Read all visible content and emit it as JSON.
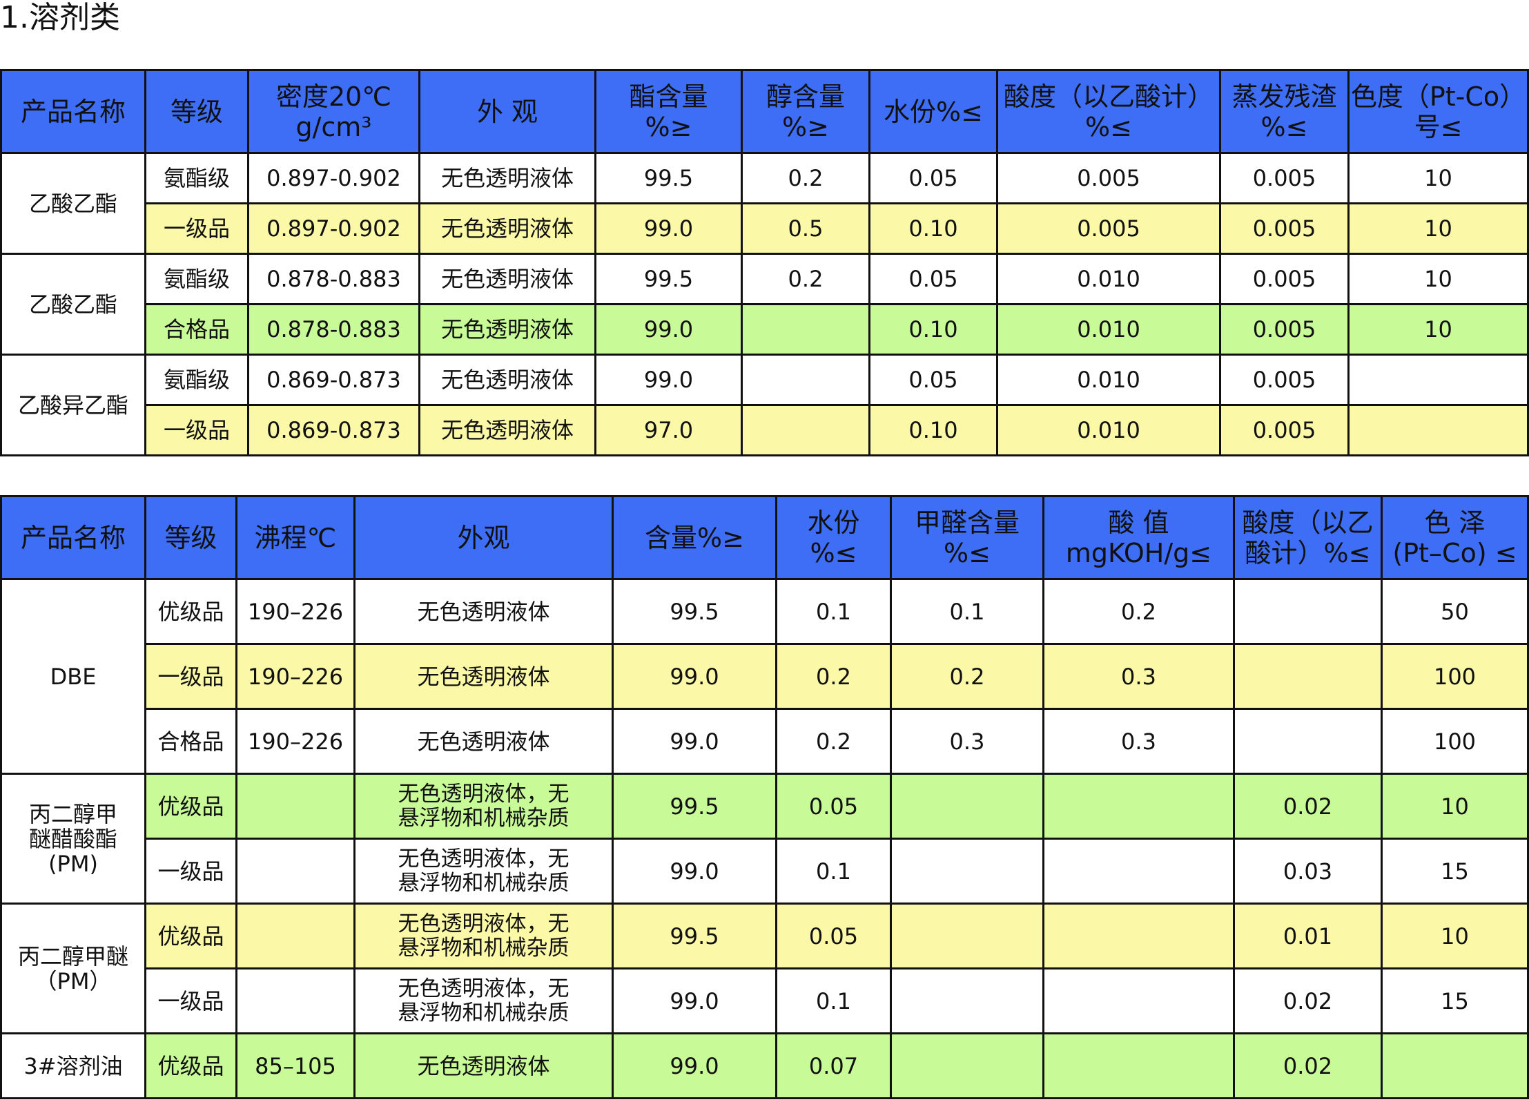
{
  "section_title": "1.溶剂类",
  "table1": {
    "headers": [
      "产品名称",
      "等级",
      "密度20℃\ng/cm³",
      "外 观",
      "酯含量\n%≥",
      "醇含量\n%≥",
      "水份%≤",
      "酸度（以乙酸计）\n%≤",
      "蒸发残渣\n%≤",
      "色度（Pt-Co）\n号≤"
    ],
    "groups": [
      {
        "name": "乙酸乙酯",
        "rows": [
          [
            "氨酯级",
            "0.897-0.902",
            "无色透明液体",
            "99.5",
            "0.2",
            "0.05",
            "0.005",
            "0.005",
            "10"
          ],
          [
            "一级品",
            "0.897-0.902",
            "无色透明液体",
            "99.0",
            "0.5",
            "0.10",
            "0.005",
            "0.005",
            "10"
          ]
        ]
      },
      {
        "name": "乙酸乙酯",
        "rows": [
          [
            "氨酯级",
            "0.878-0.883",
            "无色透明液体",
            "99.5",
            "0.2",
            "0.05",
            "0.010",
            "0.005",
            "10"
          ],
          [
            "合格品",
            "0.878-0.883",
            "无色透明液体",
            "99.0",
            "",
            "0.10",
            "0.010",
            "0.005",
            "10"
          ]
        ]
      },
      {
        "name": "乙酸异乙酯",
        "rows": [
          [
            "氨酯级",
            "0.869-0.873",
            "无色透明液体",
            "99.0",
            "",
            "0.05",
            "0.010",
            "0.005",
            ""
          ],
          [
            "一级品",
            "0.869-0.873",
            "无色透明液体",
            "97.0",
            "",
            "0.10",
            "0.010",
            "0.005",
            ""
          ]
        ]
      }
    ]
  },
  "table2": {
    "headers": [
      "产品名称",
      "等级",
      "沸程℃",
      "外观",
      "含量%≥",
      "水份\n%≤",
      "甲醛含量\n%≤",
      "酸 值\nmgKOH/g≤",
      "酸度（以乙\n酸计）%≤",
      "色 泽\n(Pt–Co) ≤"
    ],
    "groups": [
      {
        "name": "DBE",
        "rows": [
          [
            "优级品",
            "190–226",
            "无色透明液体",
            "99.5",
            "0.1",
            "0.1",
            "0.2",
            "",
            "50"
          ],
          [
            "一级品",
            "190–226",
            "无色透明液体",
            "99.0",
            "0.2",
            "0.2",
            "0.3",
            "",
            "100"
          ],
          [
            "合格品",
            "190–226",
            "无色透明液体",
            "99.0",
            "0.2",
            "0.3",
            "0.3",
            "",
            "100"
          ]
        ]
      },
      {
        "name": "丙二醇甲\n醚醋酸酯\n(PM)",
        "rows": [
          [
            "优级品",
            "",
            "无色透明液体，无\n悬浮物和机械杂质",
            "99.5",
            "0.05",
            "",
            "",
            "0.02",
            "10"
          ],
          [
            "一级品",
            "",
            "无色透明液体，无\n悬浮物和机械杂质",
            "99.0",
            "0.1",
            "",
            "",
            "0.03",
            "15"
          ]
        ]
      },
      {
        "name": "丙二醇甲醚\n（PM）",
        "rows": [
          [
            "优级品",
            "",
            "无色透明液体，无\n悬浮物和机械杂质",
            "99.5",
            "0.05",
            "",
            "",
            "0.01",
            "10"
          ],
          [
            "一级品",
            "",
            "无色透明液体，无\n悬浮物和机械杂质",
            "99.0",
            "0.1",
            "",
            "",
            "0.02",
            "15"
          ]
        ]
      },
      {
        "name": "3#溶剂油",
        "rows": [
          [
            "优级品",
            "85–105",
            "无色透明液体",
            "99.0",
            "0.07",
            "",
            "",
            "0.02",
            ""
          ]
        ]
      }
    ]
  },
  "colors": {
    "header": "#3d6ef5",
    "yellow": "#fbf8a7",
    "green": "#c8fb98",
    "white": "#ffffff"
  }
}
